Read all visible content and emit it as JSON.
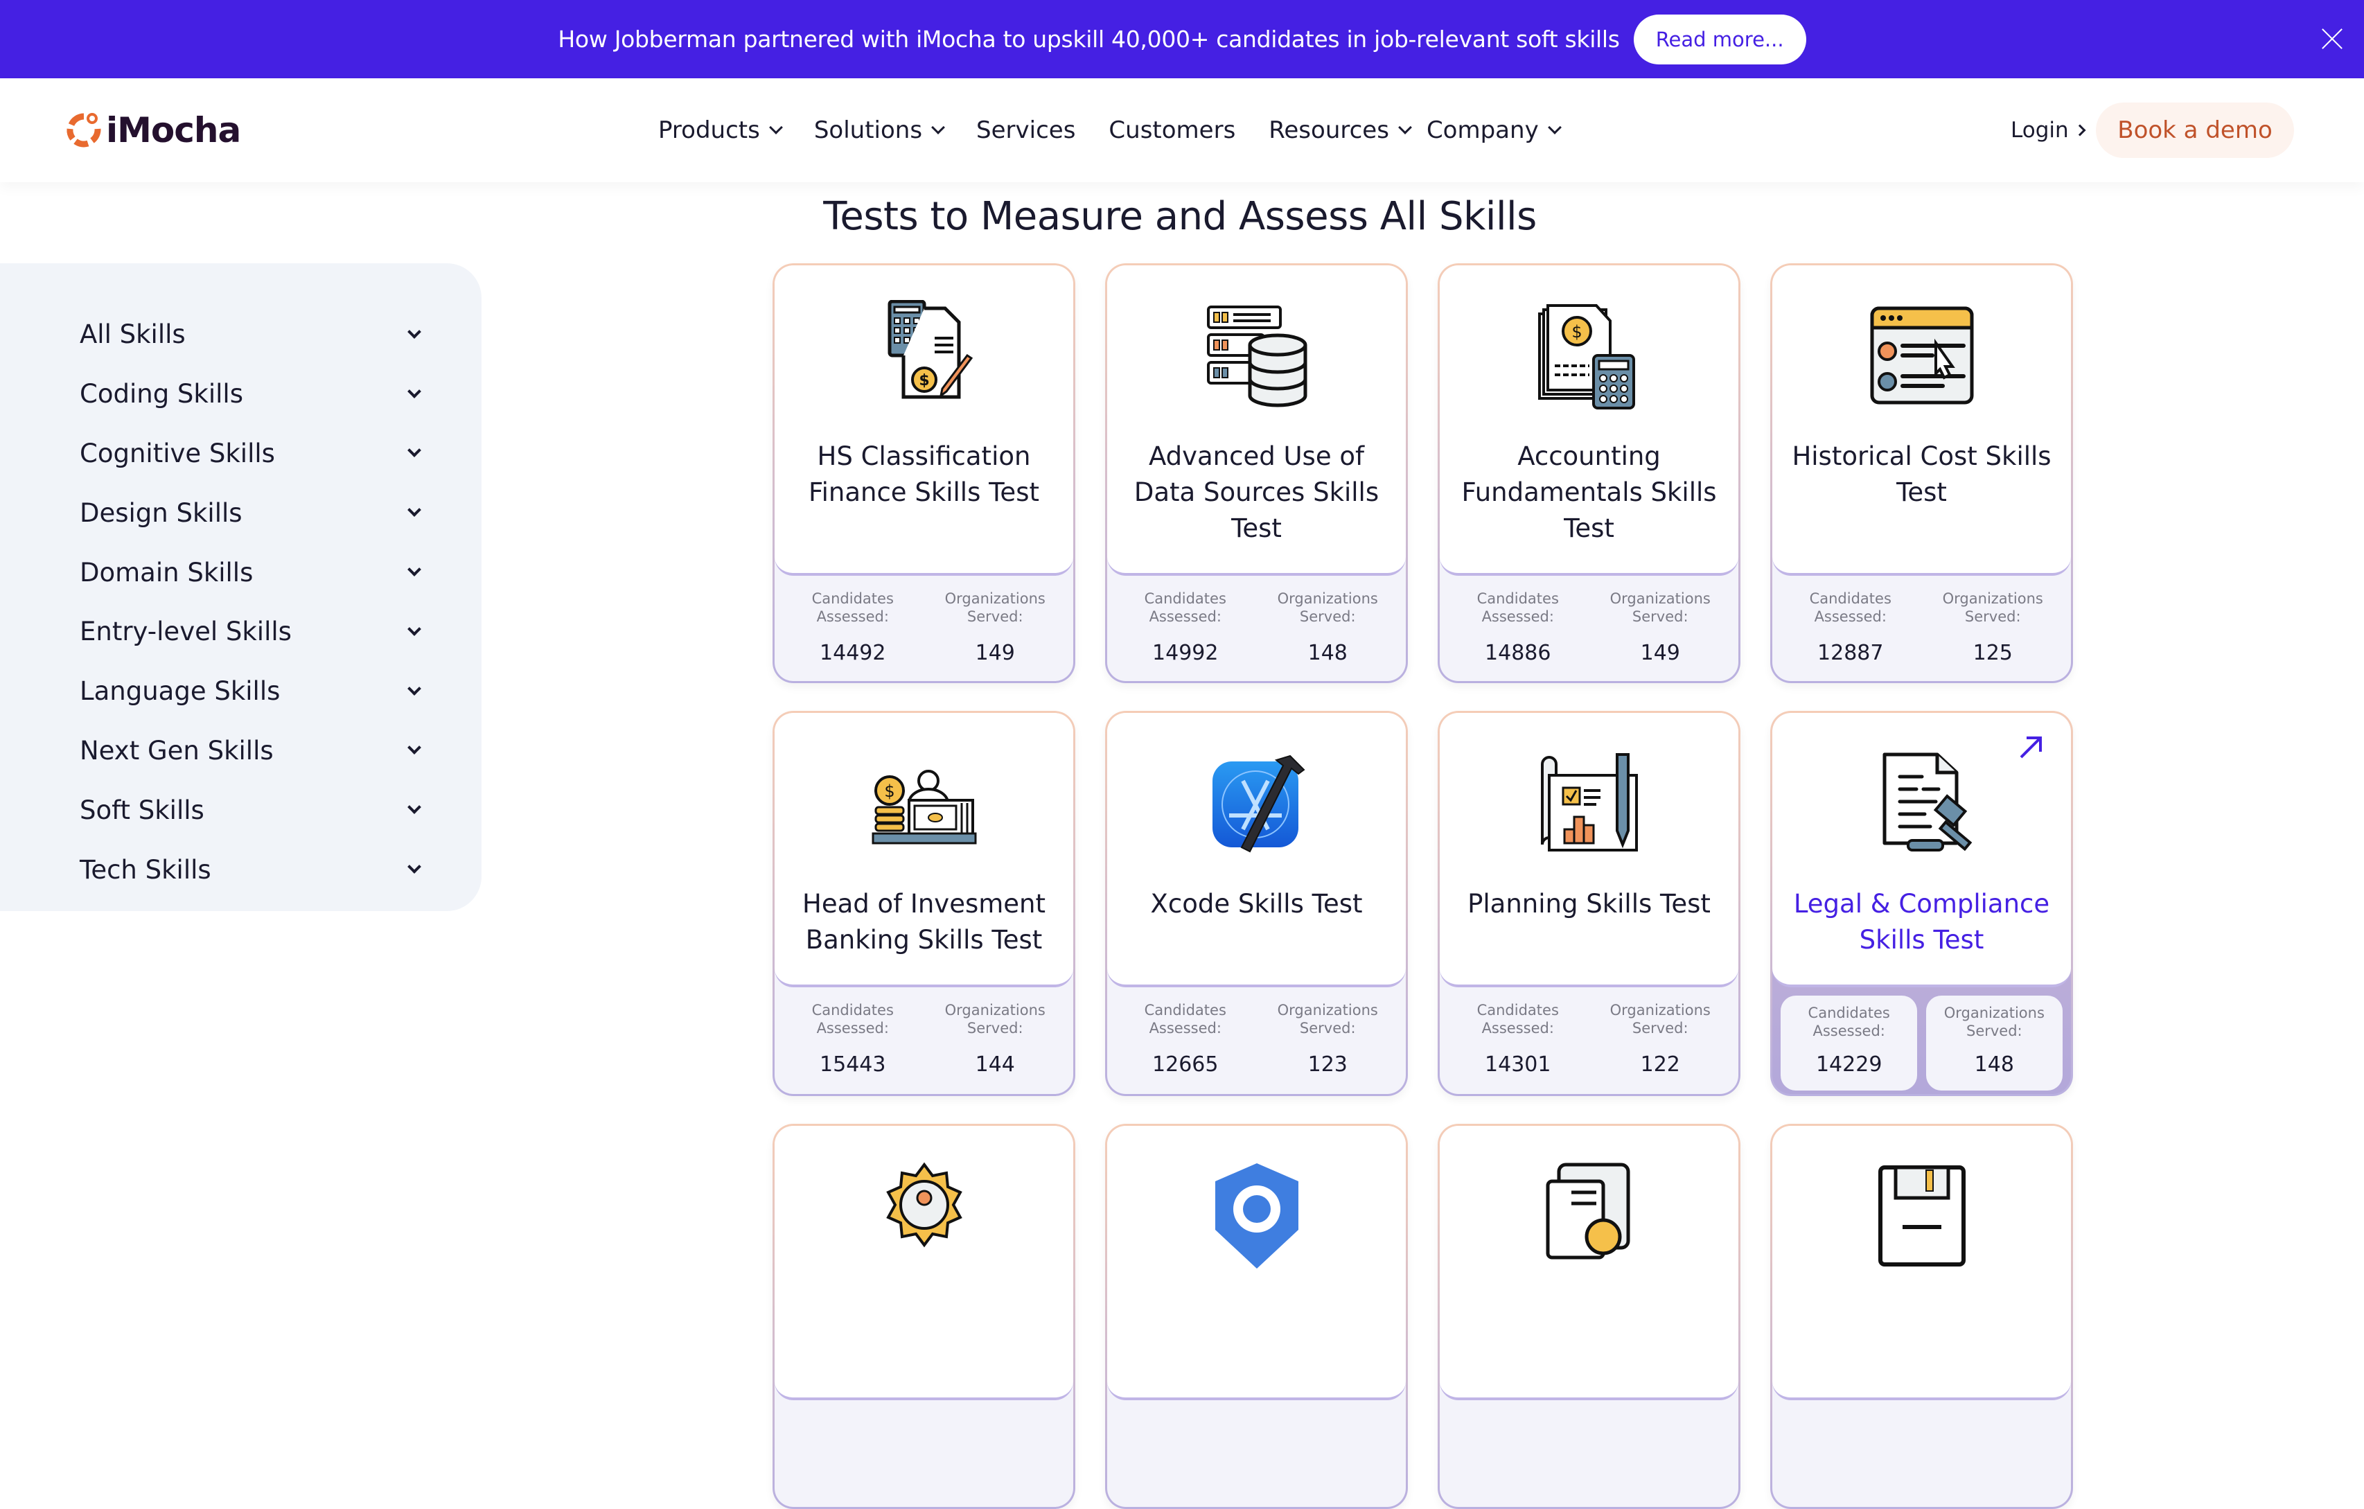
{
  "banner": {
    "text": "How Jobberman partnered with iMocha to upskill 40,000+ candidates in job-relevant soft skills",
    "button_label": "Read more...",
    "close_icon": "close-icon",
    "color": "#4520e3"
  },
  "nav": {
    "logo_text": "iMocha",
    "items": [
      {
        "label": "Products",
        "has_dropdown": true
      },
      {
        "label": "Solutions",
        "has_dropdown": true
      },
      {
        "label": "Services",
        "has_dropdown": false
      },
      {
        "label": "Customers",
        "has_dropdown": false
      },
      {
        "label": "Resources",
        "has_dropdown": true
      },
      {
        "label": "Company",
        "has_dropdown": true
      }
    ],
    "login_label": "Login",
    "demo_label": "Book a demo",
    "brand_orange": "#e86a2f",
    "brand_dark": "#24102e"
  },
  "main": {
    "title": "Tests to Measure and Assess All Skills"
  },
  "sidebar": {
    "items": [
      {
        "label": "All Skills"
      },
      {
        "label": "Coding Skills"
      },
      {
        "label": "Cognitive Skills"
      },
      {
        "label": "Design Skills"
      },
      {
        "label": "Domain Skills"
      },
      {
        "label": "Entry-level Skills"
      },
      {
        "label": "Language Skills"
      },
      {
        "label": "Next Gen Skills"
      },
      {
        "label": "Soft Skills"
      },
      {
        "label": "Tech Skills"
      }
    ]
  },
  "stat_labels": {
    "candidates_line1": "Candidates",
    "candidates_line2": "Assessed:",
    "orgs_line1": "Organizations",
    "orgs_line2": "Served:"
  },
  "cards": [
    {
      "title": "HS Classification Finance Skills Test",
      "icon": "calculator-document-icon",
      "candidates": "14492",
      "organizations": "149"
    },
    {
      "title": "Advanced Use of Data Sources Skills Test",
      "icon": "database-server-icon",
      "candidates": "14992",
      "organizations": "148"
    },
    {
      "title": "Accounting Fundamentals Skills Test",
      "icon": "invoice-calculator-icon",
      "candidates": "14886",
      "organizations": "149"
    },
    {
      "title": "Historical Cost Skills Test",
      "icon": "browser-form-icon",
      "candidates": "12887",
      "organizations": "125"
    },
    {
      "title": "Head of Invesment Banking Skills Test",
      "icon": "banker-money-icon",
      "candidates": "15443",
      "organizations": "144"
    },
    {
      "title": "Xcode Skills Test",
      "icon": "xcode-icon",
      "candidates": "12665",
      "organizations": "123"
    },
    {
      "title": "Planning Skills Test",
      "icon": "blueprint-plan-icon",
      "candidates": "14301",
      "organizations": "122"
    },
    {
      "title": "Legal & Compliance Skills Test",
      "icon": "legal-gavel-icon",
      "candidates": "14229",
      "organizations": "148",
      "hovered": true
    },
    {
      "title": "",
      "icon": "badge-person-icon"
    },
    {
      "title": "",
      "icon": "blue-gear-badge-icon"
    },
    {
      "title": "",
      "icon": "document-checklist-icon"
    },
    {
      "title": "",
      "icon": "floppy-disk-icon"
    }
  ]
}
